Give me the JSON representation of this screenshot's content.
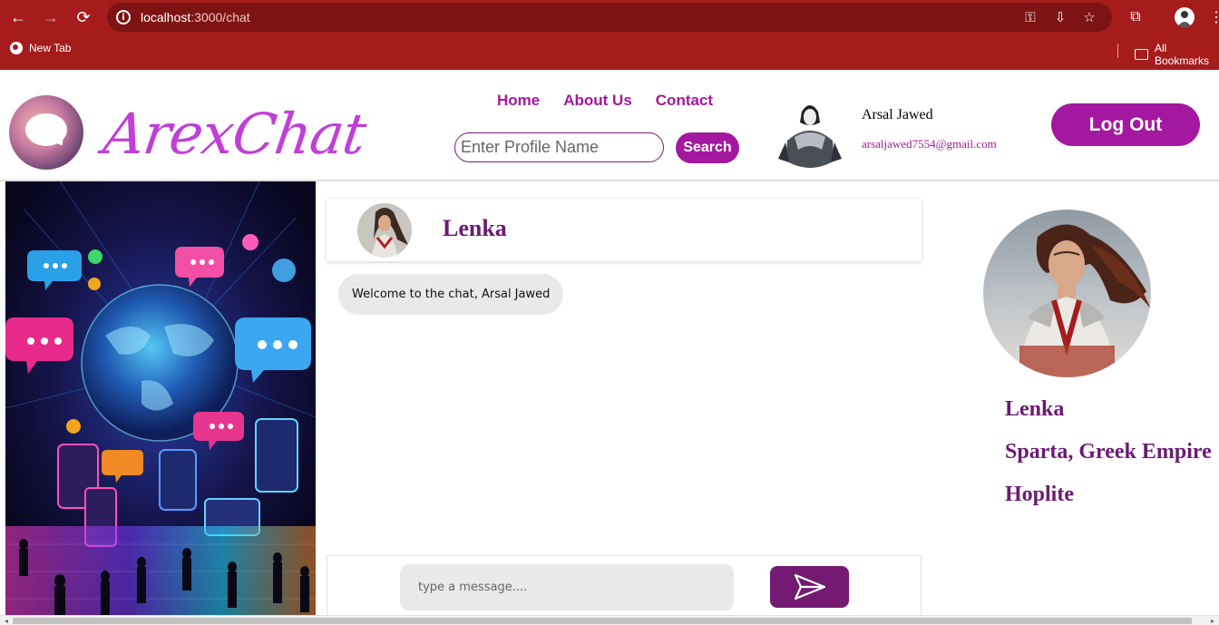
{
  "browser": {
    "url_host": "localhost",
    "url_path": ":3000/chat",
    "bookmark_new_tab": "New Tab",
    "bookmark_all": "All Bookmarks"
  },
  "header": {
    "brand": "ArexChat",
    "nav": [
      "Home",
      "About Us",
      "Contact"
    ],
    "search_placeholder": "Enter Profile Name",
    "search_button": "Search",
    "user_name": "Arsal Jawed",
    "user_email": "arsaljawed7554@gmail.com",
    "logout": "Log Out"
  },
  "chat": {
    "contact_name": "Lenka",
    "messages": [
      "Welcome to the chat, Arsal Jawed"
    ],
    "input_placeholder": "type a message...."
  },
  "profile": {
    "name": "Lenka",
    "location": "Sparta, Greek Empire",
    "role": "Hoplite"
  },
  "colors": {
    "chrome": "#a61c1c",
    "accent": "#a3189e",
    "dark_accent": "#6b1a73"
  }
}
